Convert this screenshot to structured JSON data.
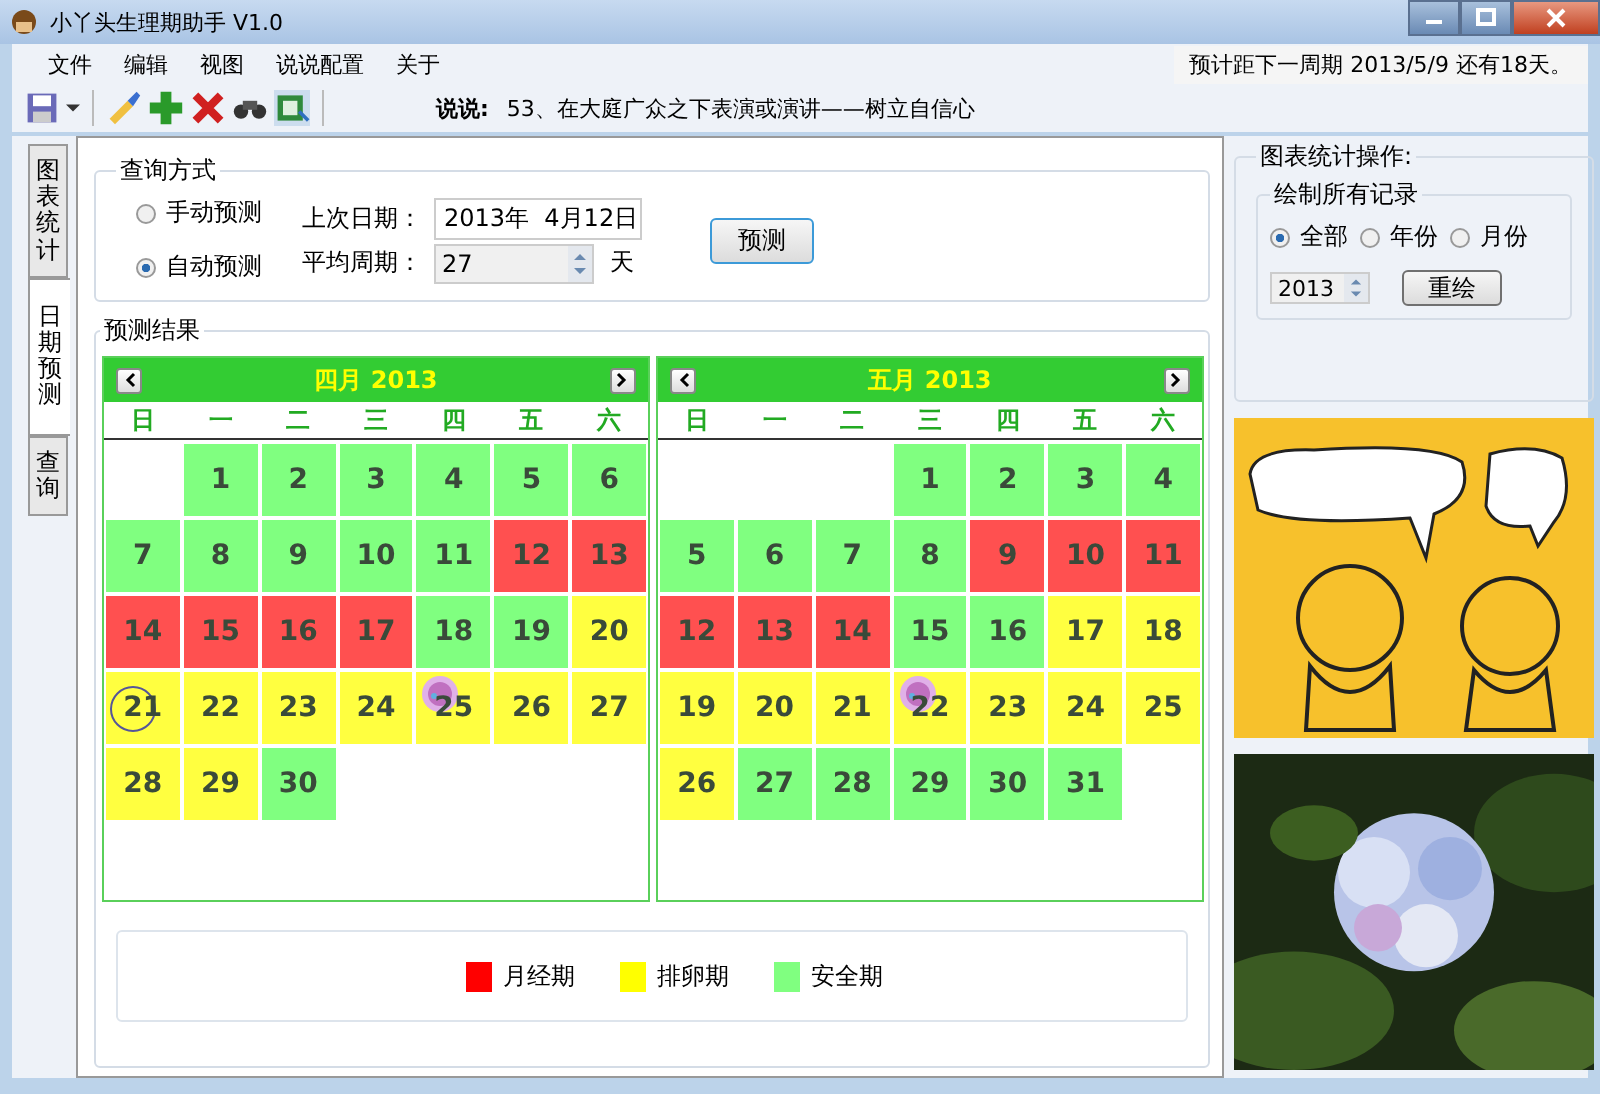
{
  "window": {
    "title": "小丫头生理期助手 V1.0"
  },
  "menu": [
    "文件",
    "编辑",
    "视图",
    "说说配置",
    "关于"
  ],
  "status_text": "预计距下一周期 2013/5/9 还有18天。",
  "toolbar": [
    {
      "kind": "save"
    },
    {
      "kind": "dropdown"
    },
    {
      "kind": "brush"
    },
    {
      "kind": "add"
    },
    {
      "kind": "delete"
    },
    {
      "kind": "binoculars"
    },
    {
      "kind": "export"
    }
  ],
  "saying": {
    "label": "说说:",
    "text": "53、在大庭广众之下表演或演讲——树立自信心"
  },
  "side_tabs": [
    {
      "label": "图表统计",
      "selected": false
    },
    {
      "label": "日期预测",
      "selected": true
    },
    {
      "label": "查询",
      "selected": false
    }
  ],
  "query": {
    "title": "查询方式",
    "modes": [
      {
        "label": "手动预测",
        "selected": false
      },
      {
        "label": "自动预测",
        "selected": true
      }
    ],
    "last_date": {
      "label": "上次日期：",
      "value": "2013年  4月12日"
    },
    "avg_cycle": {
      "label": "平均周期：",
      "value": "27",
      "unit": "天"
    },
    "button": "预测"
  },
  "results": {
    "title": "预测结果",
    "calendars": [
      {
        "title": "四月 2013",
        "weekdays": [
          "日",
          "一",
          "二",
          "三",
          "四",
          "五",
          "六"
        ],
        "days": [
          {
            "kind": "blank"
          },
          {
            "day": "1",
            "kind": "safe",
            "today": false,
            "egg": false
          },
          {
            "day": "2",
            "kind": "safe",
            "today": false,
            "egg": false
          },
          {
            "day": "3",
            "kind": "safe",
            "today": false,
            "egg": false
          },
          {
            "day": "4",
            "kind": "safe",
            "today": false,
            "egg": false
          },
          {
            "day": "5",
            "kind": "safe",
            "today": false,
            "egg": false
          },
          {
            "day": "6",
            "kind": "safe",
            "today": false,
            "egg": false
          },
          {
            "day": "7",
            "kind": "safe",
            "today": false,
            "egg": false
          },
          {
            "day": "8",
            "kind": "safe",
            "today": false,
            "egg": false
          },
          {
            "day": "9",
            "kind": "safe",
            "today": false,
            "egg": false
          },
          {
            "day": "10",
            "kind": "safe",
            "today": false,
            "egg": false
          },
          {
            "day": "11",
            "kind": "safe",
            "today": false,
            "egg": false
          },
          {
            "day": "12",
            "kind": "period",
            "today": false,
            "egg": false
          },
          {
            "day": "13",
            "kind": "period",
            "today": false,
            "egg": false
          },
          {
            "day": "14",
            "kind": "period",
            "today": false,
            "egg": false
          },
          {
            "day": "15",
            "kind": "period",
            "today": false,
            "egg": false
          },
          {
            "day": "16",
            "kind": "period",
            "today": false,
            "egg": false
          },
          {
            "day": "17",
            "kind": "period",
            "today": false,
            "egg": false
          },
          {
            "day": "18",
            "kind": "safe",
            "today": false,
            "egg": false
          },
          {
            "day": "19",
            "kind": "safe",
            "today": false,
            "egg": false
          },
          {
            "day": "20",
            "kind": "ovulation",
            "today": false,
            "egg": false
          },
          {
            "day": "21",
            "kind": "ovulation",
            "today": true,
            "egg": false
          },
          {
            "day": "22",
            "kind": "ovulation",
            "today": false,
            "egg": false
          },
          {
            "day": "23",
            "kind": "ovulation",
            "today": false,
            "egg": false
          },
          {
            "day": "24",
            "kind": "ovulation",
            "today": false,
            "egg": false
          },
          {
            "day": "25",
            "kind": "ovulation",
            "today": false,
            "egg": true
          },
          {
            "day": "26",
            "kind": "ovulation",
            "today": false,
            "egg": false
          },
          {
            "day": "27",
            "kind": "ovulation",
            "today": false,
            "egg": false
          },
          {
            "day": "28",
            "kind": "ovulation",
            "today": false,
            "egg": false
          },
          {
            "day": "29",
            "kind": "ovulation",
            "today": false,
            "egg": false
          },
          {
            "day": "30",
            "kind": "safe",
            "today": false,
            "egg": false
          }
        ]
      },
      {
        "title": "五月 2013",
        "weekdays": [
          "日",
          "一",
          "二",
          "三",
          "四",
          "五",
          "六"
        ],
        "days": [
          {
            "kind": "blank"
          },
          {
            "kind": "blank"
          },
          {
            "kind": "blank"
          },
          {
            "day": "1",
            "kind": "safe",
            "today": false,
            "egg": false
          },
          {
            "day": "2",
            "kind": "safe",
            "today": false,
            "egg": false
          },
          {
            "day": "3",
            "kind": "safe",
            "today": false,
            "egg": false
          },
          {
            "day": "4",
            "kind": "safe",
            "today": false,
            "egg": false
          },
          {
            "day": "5",
            "kind": "safe",
            "today": false,
            "egg": false
          },
          {
            "day": "6",
            "kind": "safe",
            "today": false,
            "egg": false
          },
          {
            "day": "7",
            "kind": "safe",
            "today": false,
            "egg": false
          },
          {
            "day": "8",
            "kind": "safe",
            "today": false,
            "egg": false
          },
          {
            "day": "9",
            "kind": "period",
            "today": false,
            "egg": false
          },
          {
            "day": "10",
            "kind": "period",
            "today": false,
            "egg": false
          },
          {
            "day": "11",
            "kind": "period",
            "today": false,
            "egg": false
          },
          {
            "day": "12",
            "kind": "period",
            "today": false,
            "egg": false
          },
          {
            "day": "13",
            "kind": "period",
            "today": false,
            "egg": false
          },
          {
            "day": "14",
            "kind": "period",
            "today": false,
            "egg": false
          },
          {
            "day": "15",
            "kind": "safe",
            "today": false,
            "egg": false
          },
          {
            "day": "16",
            "kind": "safe",
            "today": false,
            "egg": false
          },
          {
            "day": "17",
            "kind": "ovulation",
            "today": false,
            "egg": false
          },
          {
            "day": "18",
            "kind": "ovulation",
            "today": false,
            "egg": false
          },
          {
            "day": "19",
            "kind": "ovulation",
            "today": false,
            "egg": false
          },
          {
            "day": "20",
            "kind": "ovulation",
            "today": false,
            "egg": false
          },
          {
            "day": "21",
            "kind": "ovulation",
            "today": false,
            "egg": false
          },
          {
            "day": "22",
            "kind": "ovulation",
            "today": false,
            "egg": true
          },
          {
            "day": "23",
            "kind": "ovulation",
            "today": false,
            "egg": false
          },
          {
            "day": "24",
            "kind": "ovulation",
            "today": false,
            "egg": false
          },
          {
            "day": "25",
            "kind": "ovulation",
            "today": false,
            "egg": false
          },
          {
            "day": "26",
            "kind": "ovulation",
            "today": false,
            "egg": false
          },
          {
            "day": "27",
            "kind": "safe",
            "today": false,
            "egg": false
          },
          {
            "day": "28",
            "kind": "safe",
            "today": false,
            "egg": false
          },
          {
            "day": "29",
            "kind": "safe",
            "today": false,
            "egg": false
          },
          {
            "day": "30",
            "kind": "safe",
            "today": false,
            "egg": false
          },
          {
            "day": "31",
            "kind": "safe",
            "today": false,
            "egg": false
          }
        ]
      }
    ],
    "legend": [
      {
        "label": "月经期",
        "color": "#ff0000"
      },
      {
        "label": "排卵期",
        "color": "#ffff00"
      },
      {
        "label": "安全期",
        "color": "#80ff80"
      }
    ]
  },
  "chart_ops": {
    "title": "图表统计操作:",
    "group": "绘制所有记录",
    "scopes": [
      {
        "label": "全部",
        "selected": true
      },
      {
        "label": "年份",
        "selected": false
      },
      {
        "label": "月份",
        "selected": false
      }
    ],
    "year": "2013",
    "button": "重绘"
  }
}
